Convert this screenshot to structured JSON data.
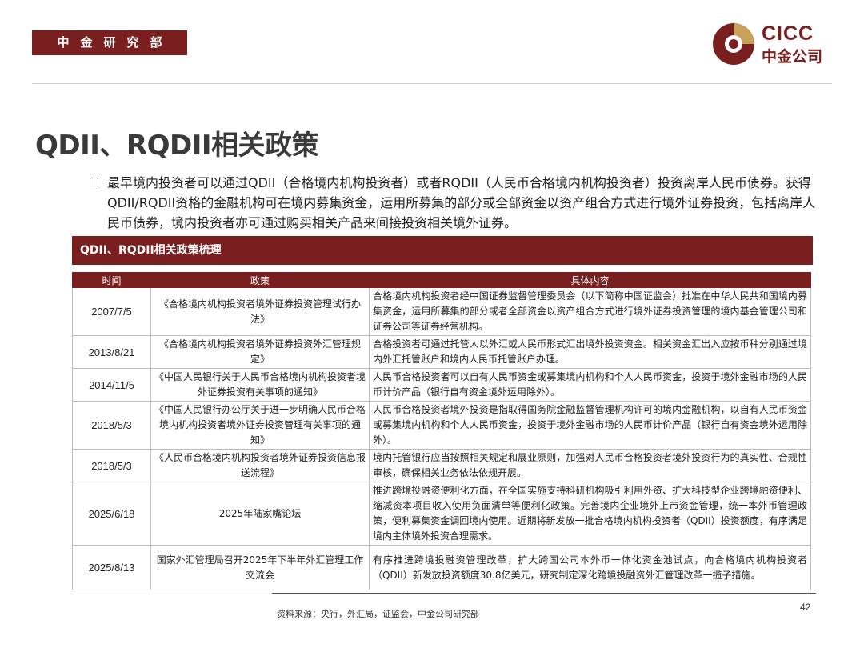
{
  "header": {
    "dept_label": "中金研究部",
    "logo_en": "CICC",
    "logo_cn": "中金公司",
    "brand_color": "#7a1f1f",
    "accent_color": "#c8a25a"
  },
  "title": "QDII、RQDII相关政策",
  "intro": "最早境内投资者可以通过QDII（合格境内机构投资者）或者RQDII（人民币合格境内机构投资者）投资离岸人民币债券。获得QDII/RQDII资格的金融机构可在境内募集资金，运用所募集的部分或全部资金以资产组合方式进行境外证券投资，包括离岸人民币债券，境内投资者亦可通过购买相关产品来间接投资相关境外证券。",
  "panel_title": "QDII、RQDII相关政策梳理",
  "table": {
    "headers": [
      "时间",
      "政策",
      "具体内容"
    ],
    "rows": [
      {
        "date": "2007/7/5",
        "policy": "《合格境内机构投资者境外证券投资管理试行办法》",
        "content": "合格境内机构投资者经中国证券监督管理委员会（以下简称中国证监会）批准在中华人民共和国境内募集资金，运用所募集的部分或者全部资金以资产组合方式进行境外证券投资管理的境内基金管理公司和证券公司等证券经营机构。"
      },
      {
        "date": "2013/8/21",
        "policy": "《合格境内机构投资者境外证券投资外汇管理规定》",
        "content": "合格投资者可通过托管人以外汇或人民币形式汇出境外投资资金。相关资金汇出入应按币种分别通过境内外汇托管账户和境内人民币托管账户办理。"
      },
      {
        "date": "2014/11/5",
        "policy": "《中国人民银行关于人民币合格境内机构投资者境外证券投资有关事项的通知》",
        "content": "人民币合格投资者可以自有人民币资金或募集境内机构和个人人民币资金，投资于境外金融市场的人民币计价产品（银行自有资金境外运用除外）。"
      },
      {
        "date": "2018/5/3",
        "policy": "《中国人民银行办公厅关于进一步明确人民币合格境内机构投资者境外证券投资管理有关事项的通知》",
        "content": "人民币合格投资者境外投资是指取得国务院金融监督管理机构许可的境内金融机构，以自有人民币资金或募集境内机构和个人人民币资金，投资于境外金融市场的人民币计价产品（银行自有资金境外运用除外）。"
      },
      {
        "date": "2018/5/3",
        "policy": "《人民币合格境内机构投资者境外证券投资信息报送流程》",
        "content": "境内托管银行应当按照相关规定和展业原则，加强对人民币合格投资者境外投资行为的真实性、合规性审核，确保相关业务依法依规开展。"
      },
      {
        "date": "2025/6/18",
        "policy": "2025年陆家嘴论坛",
        "content": "推进跨境投融资便利化方面，在全国实施支持科研机构吸引利用外资、扩大科技型企业跨境融资便利、缩减资本项目收入使用负面清单等便利化政策。完善境内企业境外上市资金管理，统一本外币管理政策，便利募集资金调回境内使用。近期将新发放一批合格境内机构投资者（QDII）投资额度，有序满足境内主体境外投资合理需求。"
      },
      {
        "date": "2025/8/13",
        "policy": "国家外汇管理局召开2025年下半年外汇管理工作交流会",
        "content": "有序推进跨境投融资管理改革，扩大跨国公司本外币一体化资金池试点，向合格境内机构投资者（QDII）新发放投资额度30.8亿美元，研究制定深化跨境投融资外汇管理改革一揽子措施。"
      }
    ]
  },
  "source": "资料来源：央行，外汇局，证监会，中金公司研究部",
  "page_number": "42"
}
